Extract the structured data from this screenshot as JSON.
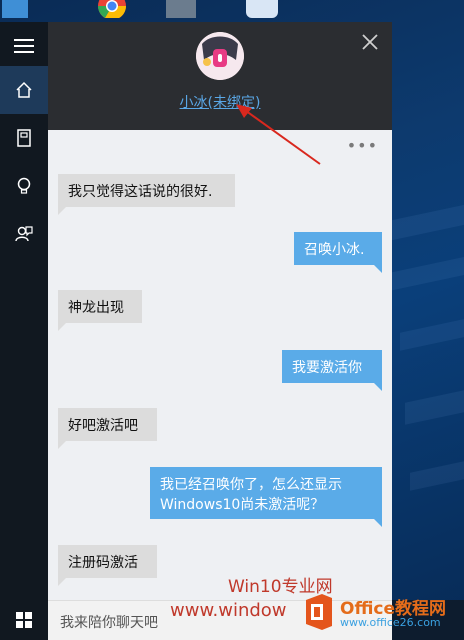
{
  "header": {
    "bot_name_link": "小冰(未绑定)"
  },
  "messages": [
    {
      "from": "bot",
      "text": "我只觉得这话说的很好."
    },
    {
      "from": "user",
      "text": "召唤小冰."
    },
    {
      "from": "bot",
      "text": "神龙出现"
    },
    {
      "from": "user",
      "text": "我要激活你"
    },
    {
      "from": "bot",
      "text": "好吧激活吧"
    },
    {
      "from": "user",
      "text": "我已经召唤你了，怎么还显示Windows10尚未激活呢？"
    },
    {
      "from": "bot",
      "text": "注册码激活"
    }
  ],
  "input": {
    "placeholder": "我来陪你聊天吧"
  },
  "watermarks": {
    "line1": "Win10专业网",
    "line2": "www.window",
    "office_brand": "Office教程网",
    "office_url": "www.office26.com"
  },
  "colors": {
    "accent_blue": "#5aabe8",
    "bot_bubble": "#dcdcdc",
    "header_bg": "#2b2d31",
    "rail_bg": "#111820"
  },
  "icons": [
    "hamburger-menu-icon",
    "home-icon",
    "notebook-icon",
    "lightbulb-icon",
    "feedback-icon",
    "close-icon",
    "more-dots-icon",
    "windows-start-icon"
  ]
}
